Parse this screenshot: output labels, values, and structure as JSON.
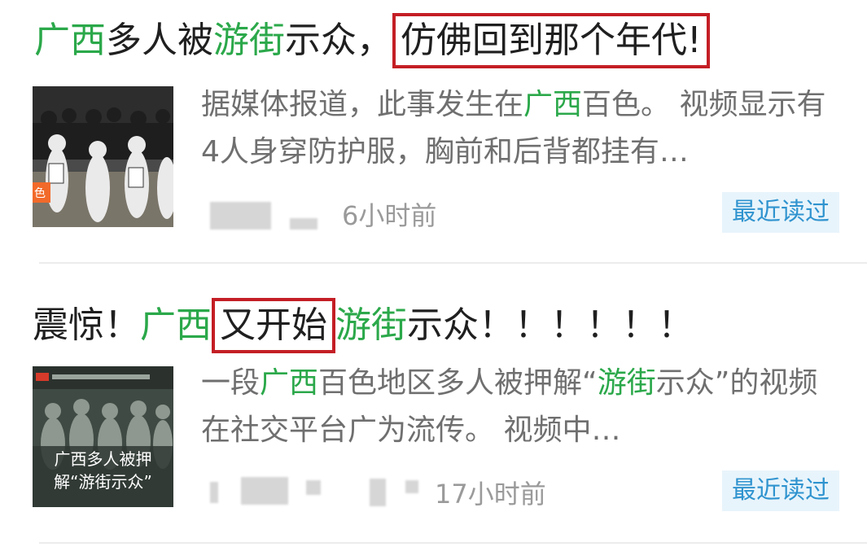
{
  "items": [
    {
      "title_parts": [
        {
          "text": "广西",
          "highlight": true
        },
        {
          "text": "多人被",
          "highlight": false
        },
        {
          "text": "游街",
          "highlight": true
        },
        {
          "text": "示众，",
          "highlight": false
        }
      ],
      "title_boxed": "仿佛回到那个年代!",
      "summary_parts": [
        {
          "text": "据媒体报道，此事发生在",
          "highlight": false
        },
        {
          "text": "广西",
          "highlight": true
        },
        {
          "text": "百色。 视频显示有4人身穿防护服，胸前和后背都挂有…",
          "highlight": false
        }
      ],
      "time": "6小时前",
      "badge": "最近读过"
    },
    {
      "title_pre": "震惊！",
      "title_region": "广西",
      "title_boxed": "又开始",
      "title_hl": "游街",
      "title_post": "示众！！！！！！",
      "summary_parts": [
        {
          "text": "一段",
          "highlight": false
        },
        {
          "text": "广西",
          "highlight": true
        },
        {
          "text": "百色地区多人被押解“",
          "highlight": false
        },
        {
          "text": "游街",
          "highlight": true
        },
        {
          "text": "示众”的视频在社交平台广为流传。 视频中…",
          "highlight": false
        }
      ],
      "thumb_caption_line1": "广西多人被押",
      "thumb_caption_line2": "解“游街示众”",
      "time": "17小时前",
      "badge": "最近读过"
    }
  ],
  "colors": {
    "highlight": "#2ba84a",
    "box": "#c41e25",
    "badge_bg": "#e8f4fb",
    "badge_text": "#2f93cf"
  }
}
